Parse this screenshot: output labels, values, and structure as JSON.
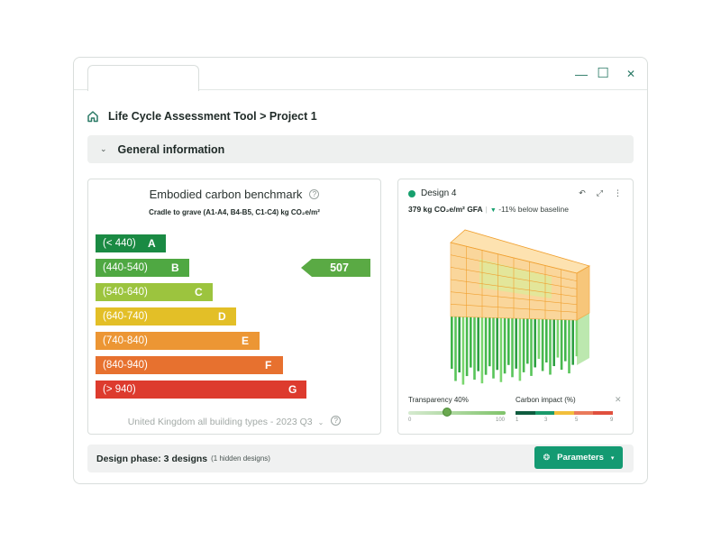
{
  "window": {
    "controls": {
      "minimize": "—",
      "maximize": "☐",
      "close": "✕"
    }
  },
  "breadcrumb": {
    "icon": "home-icon",
    "label": "Life Cycle Assessment Tool > Project 1"
  },
  "section": {
    "chevron": "⌄",
    "title": "General information"
  },
  "benchmark": {
    "title": "Embodied carbon benchmark",
    "help": "?",
    "subtitle": "Cradle to grave (A1-A4, B4-B5, C1-C4) kg CO₂e/m²",
    "bands": [
      {
        "range": "(< 440)",
        "grade": "A",
        "color": "#1a8a43"
      },
      {
        "range": "(440-540)",
        "grade": "B",
        "color": "#4fa842"
      },
      {
        "range": "(540-640)",
        "grade": "C",
        "color": "#9cc43e"
      },
      {
        "range": "(640-740)",
        "grade": "D",
        "color": "#e3bf27"
      },
      {
        "range": "(740-840)",
        "grade": "E",
        "color": "#ec9634"
      },
      {
        "range": "(840-940)",
        "grade": "F",
        "color": "#e7712f"
      },
      {
        "range": "(> 940)",
        "grade": "G",
        "color": "#dd3b2e"
      }
    ],
    "pointer_value": "507",
    "region": "United Kingdom all building types - 2023 Q3",
    "region_dropdown": "⌄"
  },
  "design": {
    "name": "Design 4",
    "value": "379 kg CO₂e/m² GFA",
    "separator": "|",
    "arrow": "▼",
    "delta": "-11% below baseline",
    "icons": {
      "undo": "↶",
      "expand": "⤢",
      "more": "⋮"
    },
    "transparency_label": "Transparency 40%",
    "transparency": 0.4,
    "transparency_min": "0",
    "transparency_max": "100",
    "impact_label": "Carbon impact (%)",
    "impact_ticks": [
      "1",
      "3",
      "5",
      "9"
    ],
    "impact_colors": [
      "#0f5c3f",
      "#1a9a6a",
      "#f2bf3b",
      "#ea7a5b",
      "#e0503e"
    ],
    "close": "✕"
  },
  "footer": {
    "phase": "Design phase: 3 designs",
    "hidden": "(1 hidden designs)",
    "button": "Parameters",
    "button_icon": "❂",
    "button_caret": "▾"
  }
}
